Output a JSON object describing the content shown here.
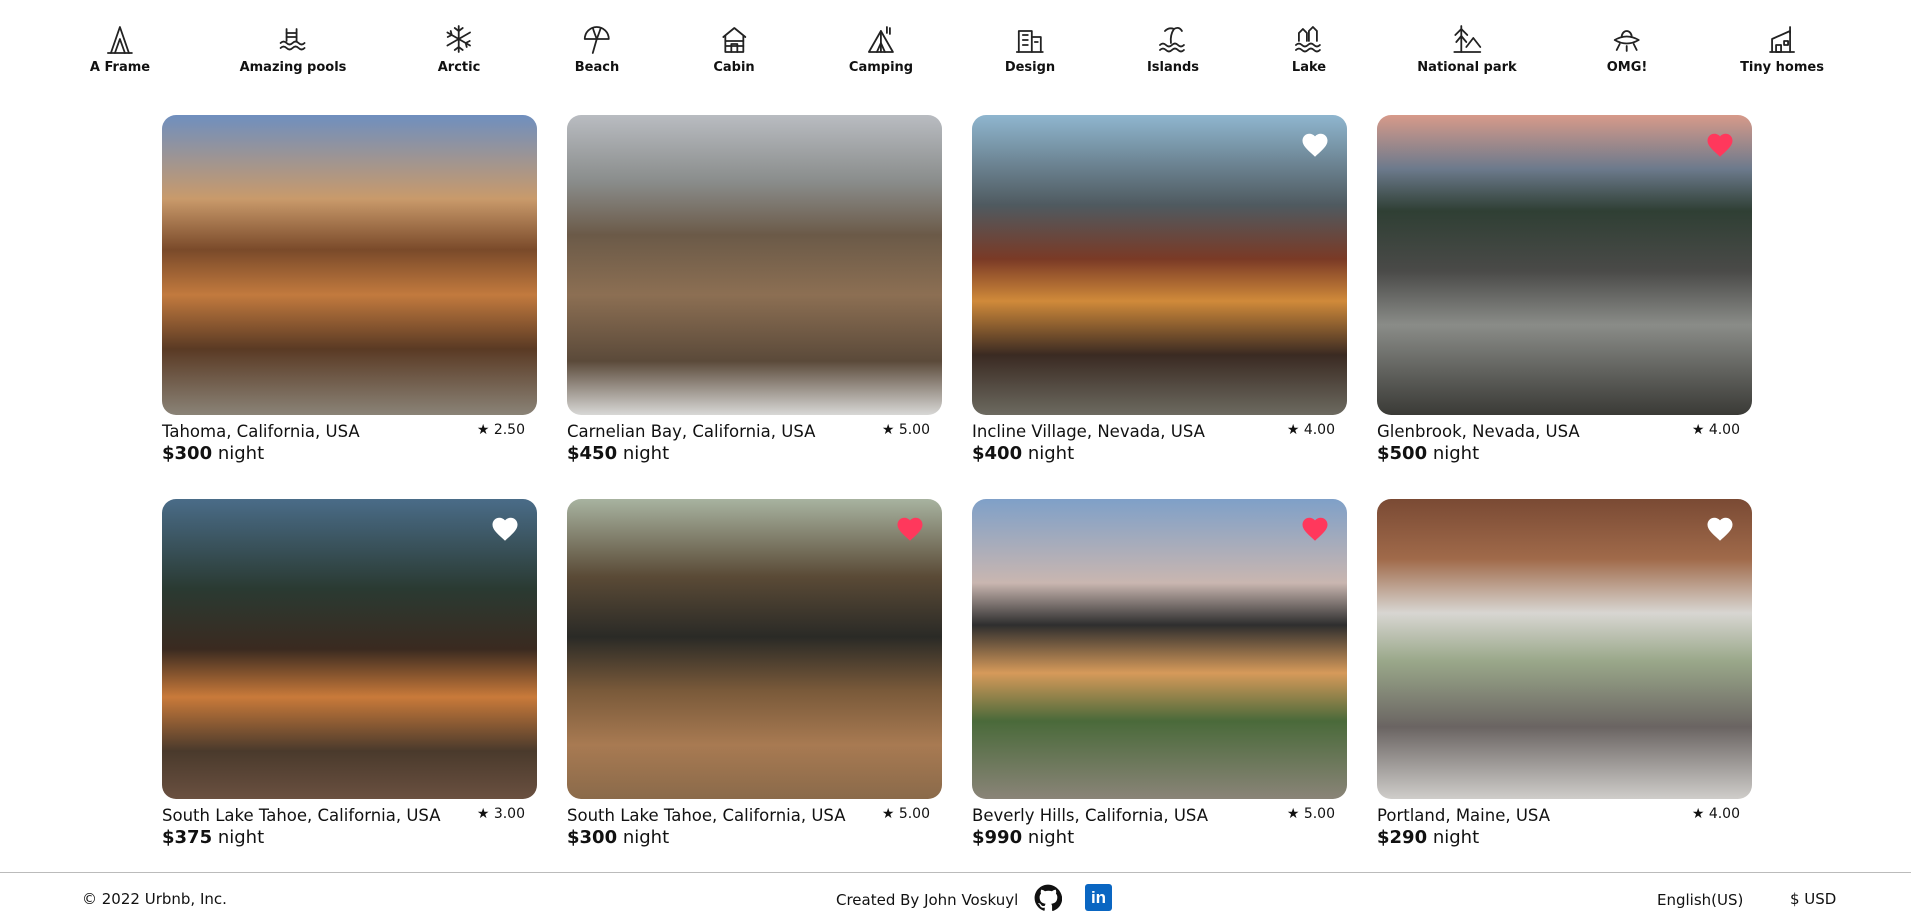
{
  "categories": [
    {
      "label": "A Frame",
      "icon": "a-frame-icon"
    },
    {
      "label": "Amazing pools",
      "icon": "pool-icon"
    },
    {
      "label": "Arctic",
      "icon": "snowflake-icon"
    },
    {
      "label": "Beach",
      "icon": "umbrella-icon"
    },
    {
      "label": "Cabin",
      "icon": "cabin-icon"
    },
    {
      "label": "Camping",
      "icon": "tent-icon"
    },
    {
      "label": "Design",
      "icon": "design-building-icon"
    },
    {
      "label": "Islands",
      "icon": "island-icon"
    },
    {
      "label": "Lake",
      "icon": "lake-icon"
    },
    {
      "label": "National park",
      "icon": "national-park-icon"
    },
    {
      "label": "OMG!",
      "icon": "ufo-icon"
    },
    {
      "label": "Tiny homes",
      "icon": "tiny-home-icon"
    }
  ],
  "listings": [
    {
      "location": "Tahoma, California, USA",
      "rating": "★ 2.50",
      "price": "$300",
      "unit": "night",
      "favorite": "none",
      "photo": "lodge-dusk"
    },
    {
      "location": "Carnelian Bay, California, USA",
      "rating": "★ 5.00",
      "price": "$450",
      "unit": "night",
      "favorite": "none",
      "photo": "wood-house"
    },
    {
      "location": "Incline Village, Nevada, USA",
      "rating": "★ 4.00",
      "price": "$400",
      "unit": "night",
      "favorite": "white",
      "photo": "lake-house-night"
    },
    {
      "location": "Glenbrook, Nevada, USA",
      "rating": "★ 4.00",
      "price": "$500",
      "unit": "night",
      "favorite": "red",
      "photo": "modern-mountain"
    },
    {
      "location": "South Lake Tahoe, California, USA",
      "rating": "★ 3.00",
      "price": "$375",
      "unit": "night",
      "favorite": "white",
      "photo": "a-frame-forest"
    },
    {
      "location": "South Lake Tahoe, California, USA",
      "rating": "★ 5.00",
      "price": "$300",
      "unit": "night",
      "favorite": "red",
      "photo": "cabin-deck"
    },
    {
      "location": "Beverly Hills, California, USA",
      "rating": "★ 5.00",
      "price": "$990",
      "unit": "night",
      "favorite": "red",
      "photo": "modern-villa"
    },
    {
      "location": "Portland, Maine, USA",
      "rating": "★ 4.00",
      "price": "$290",
      "unit": "night",
      "favorite": "white",
      "photo": "living-room"
    }
  ],
  "footer": {
    "copyright": "© 2022 Urbnb, Inc.",
    "created_by": "Created By John Voskuyl",
    "language": "English(US)",
    "currency": "$ USD",
    "linkedin_glyph": "in"
  },
  "colors": {
    "heart_red": "#ff385c",
    "heart_white": "#ffffff",
    "linkedin_blue": "#0a66c2"
  }
}
